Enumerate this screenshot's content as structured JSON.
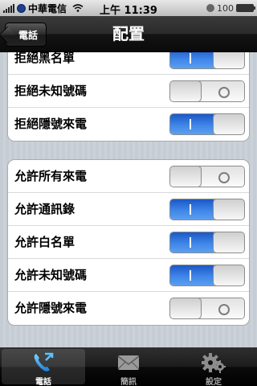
{
  "status_bar": {
    "carrier": "中華電信",
    "time": "上午 11:39",
    "battery_percent": "100"
  },
  "nav": {
    "back_label": "電話",
    "title": "配置"
  },
  "groups": [
    {
      "rows": [
        {
          "label": "拒絕黑名單",
          "on": true
        },
        {
          "label": "拒絕未知號碼",
          "on": false
        },
        {
          "label": "拒絕隱號來電",
          "on": true
        }
      ]
    },
    {
      "rows": [
        {
          "label": "允許所有來電",
          "on": false
        },
        {
          "label": "允許通訊錄",
          "on": true
        },
        {
          "label": "允許白名單",
          "on": true
        },
        {
          "label": "允許未知號碼",
          "on": true
        },
        {
          "label": "允許隱號來電",
          "on": false
        }
      ]
    }
  ],
  "tabs": [
    {
      "label": "電話",
      "icon": "phone-icon",
      "active": true
    },
    {
      "label": "簡訊",
      "icon": "envelope-icon",
      "active": false
    },
    {
      "label": "設定",
      "icon": "gear-icon",
      "active": false
    }
  ],
  "colors": {
    "switch_on": "#3f86e8",
    "nav_bar": "#1c1c1c",
    "background": "#c5ccd4"
  }
}
